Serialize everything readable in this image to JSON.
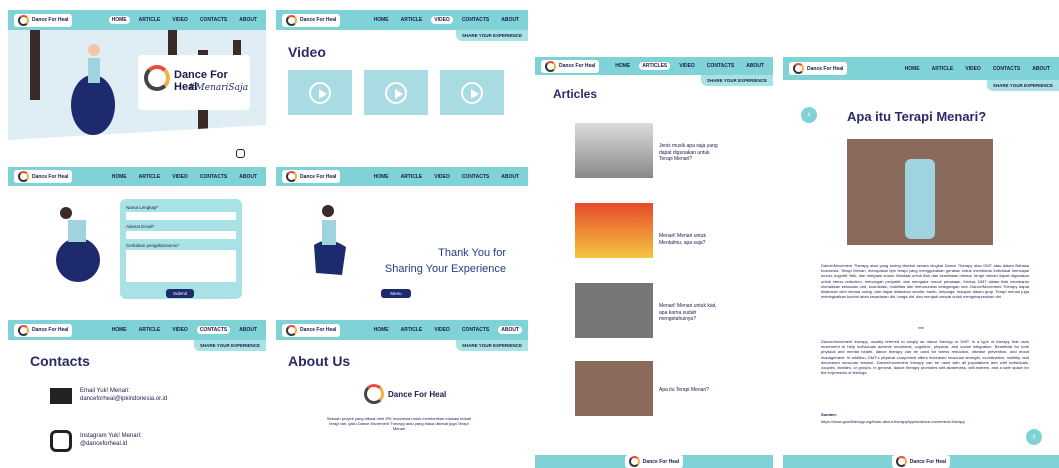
{
  "brand": {
    "name": "Dance For Heal",
    "hashtag": "#MenariSaja"
  },
  "nav": {
    "home": "HOME",
    "article": "ARTICLE",
    "articles": "ARTICLES",
    "video": "VIDEO",
    "contacts": "CONTACTS",
    "about": "ABOUT"
  },
  "share": "SHARE YOUR EXPERIENCE",
  "video": {
    "title": "Video"
  },
  "form": {
    "name": "Nama Lengkap*",
    "email": "Alamat Email*",
    "story": "Ceritakan pengalamanmu*",
    "submit": "Submit"
  },
  "thanks": {
    "line1": "Thank You for",
    "line2": "Sharing Your Experience",
    "menu": "Menu"
  },
  "contacts": {
    "title": "Contacts",
    "email_label": "Email Yuk! Menari:",
    "email": "danceforheal@ipkindonesia.or.id",
    "ig_label": "Instagram Yuk! Menari:",
    "ig": "@danceforheal.id"
  },
  "about": {
    "title": "About Us",
    "text": "Sebuah proyek yang dibuat oleh IPK Indonesia untuk memberikan edukasi terkait terapi tari, yaitu Dance Movement Therapy atau yang biasa dikenal juga Terapi Menari"
  },
  "articles": {
    "title": "Articles",
    "items": [
      "Jenis musik apa saja yang dapat digunakan untuk Terapi Menari?",
      "Menari! Menari untuk Mentalmu, apa saja?",
      "Menari! Menari untuk kiat, apa karna sudah mengetahuinya?",
      "Apa itu Terapi Menari?"
    ]
  },
  "detail": {
    "title": "Apa itu Terapi Menari?",
    "p1": "Dance/Movement Therapy atau yang sering disebut secara singkat Dance Therapy atau DMT atau dalam Bahasa Indonesia, Terapi Menari, merupakan tipe terapi yang menggunakan gerakan untuk membantu individual mencapai emosi, kognitif, fisik, dan integrasi sosial. Manfaat untuk fisik dan kesehatan mental, terapi menari dapat digunakan untuk stress reduction, mencegah penyakit, dan mengatur mood/ perasaan. Kedua, DMT dalam fisik membantu menaikkan kekuatan otot, koordinasi, mobilitas dan menurunkan ketegangan otot. Dance/Movement Therapy dapat dilakukan oleh semua orang, dan dapat dilakukan sendiri, bantu, keluarga, maupun dalam grup. Terapi menari juga meningkatkan kontrol akan kesadaran diri, harga diri, dan menjadi cenpat untuk mengekspresikan diri.",
    "sep": "***",
    "p2": "Dance/movement therapy, usually referred to simply as dance therapy or DMT, is a type of therapy that uses movement to help individuals achieve emotional, cognitive, physical, and social integration. Beneficial for both physical and mental health, dance therapy can be used for stress reduction, disease prevention, and mood management. In addition, DMT's physical component offers increased muscular strength, coordination, mobility, and decreased muscular tension. Dance/movement therapy can be used with all populations and with individuals, couples, families, or groups. In general, dance therapy promotes self-awareness, self-esteem, and a safe space for the expression of feelings.",
    "source_label": "Sumber:",
    "source": "https://www.goodtherapy.org/learn-about-therapy/types/dance-movement-therapy"
  }
}
